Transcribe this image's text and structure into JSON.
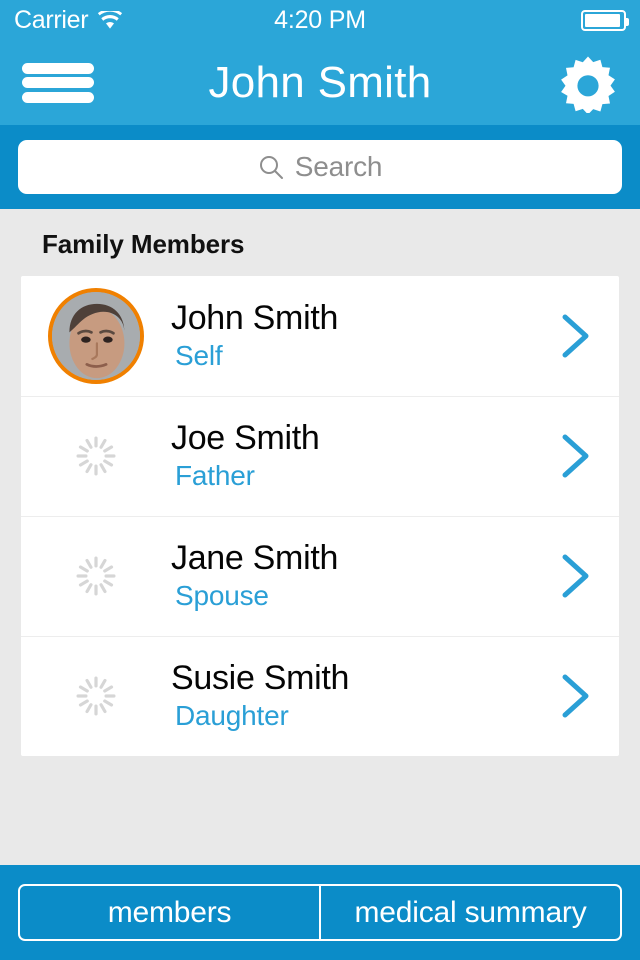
{
  "status_bar": {
    "carrier": "Carrier",
    "wifi_icon": "wifi-icon",
    "time": "4:20 PM",
    "battery_icon": "battery-icon"
  },
  "nav_bar": {
    "menu_icon": "hamburger-menu-icon",
    "title": "John Smith",
    "settings_icon": "gear-icon"
  },
  "search": {
    "icon": "search-icon",
    "placeholder": "Search",
    "value": ""
  },
  "main": {
    "section_title": "Family Members",
    "members": [
      {
        "name": "John Smith",
        "relationship": "Self",
        "avatar": "photo",
        "chevron": "chevron-right-icon"
      },
      {
        "name": "Joe Smith",
        "relationship": "Father",
        "avatar": "loading",
        "chevron": "chevron-right-icon"
      },
      {
        "name": "Jane Smith",
        "relationship": "Spouse",
        "avatar": "loading",
        "chevron": "chevron-right-icon"
      },
      {
        "name": "Susie Smith",
        "relationship": "Daughter",
        "avatar": "loading",
        "chevron": "chevron-right-icon"
      }
    ]
  },
  "bottom_tabs": {
    "selected": "members",
    "items": [
      {
        "label": "members"
      },
      {
        "label": "medical summary"
      }
    ]
  },
  "colors": {
    "nav_blue": "#2ba6d8",
    "bar_blue": "#0b8cc8",
    "accent_blue": "#2a9fd6",
    "avatar_ring": "#f08000",
    "page_bg": "#e9e9e9"
  }
}
